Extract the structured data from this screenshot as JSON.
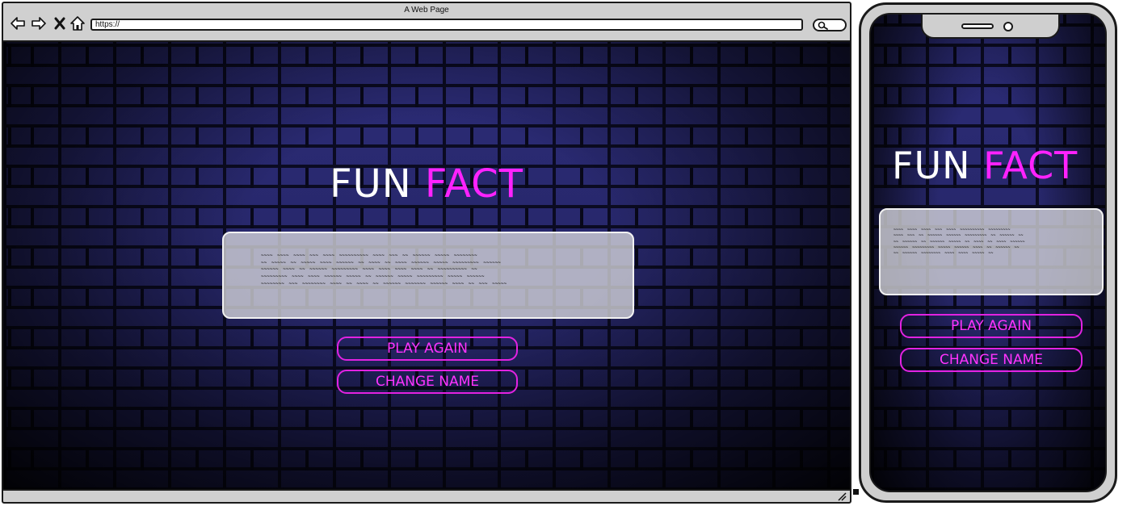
{
  "browser": {
    "window_title": "A Web Page",
    "url": "https://"
  },
  "page": {
    "title_word_1": "FUN",
    "title_word_2": "FACT",
    "fact_lines": [
      "~~~~ ~~~~ ~~~~ ~~~ ~~~~ ~~~~~~~~~~ ~~~~ ~~~ ~~ ~~~~~~ ~~~~~ ~~~~~~~~",
      "~~ ~~~~~ ~~ ~~~~~ ~~~~ ~~~~~~ ~~ ~~~~ ~~ ~~~~ ~~~~~~ ~~~~~ ~~~~~~~~~ ~~~~~~",
      "~~~~~~ ~~~~ ~~ ~~~~~~ ~~~~~~~~~ ~~~~ ~~~~ ~~~~ ~~~~ ~~ ~~~~~~~~~~ ~~",
      "~~~~~~~~~ ~~~~ ~~~~ ~~~~~~ ~~~~~ ~~ ~~~~~~ ~~~~~ ~~~~~~~~~ ~~~~~ ~~~~~~",
      "~~~~~~~~ ~~~ ~~~~~~~~ ~~~~ ~~ ~~~~ ~~ ~~~~~~ ~~~~~~~ ~~~~~~ ~~~~ ~~ ~~~ ~~~~~"
    ],
    "play_again_label": "PLAY AGAIN",
    "change_name_label": "CHANGE NAME"
  },
  "mobile": {
    "title_word_1": "FUN",
    "title_word_2": "FACT",
    "fact_lines": [
      "~~~~ ~~~~ ~~~~ ~~~ ~~~~ ~~~~~~~~~~ ~~~~~~~~~",
      "~~~~ ~~~ ~~ ~~~~~~ ~~~~~~ ~~~~~~~~~ ~~ ~~~~~~ ~~",
      "~~ ~~~~~~ ~~ ~~~~~~ ~~~~~ ~~ ~~~~ ~~ ~~~~ ~~~~~~",
      "~~~~~~ ~~~~~~~~~ ~~~~~ ~~~~~~ ~~~~ ~~ ~~~~~~ ~~",
      "~~ ~~~~~~ ~~~~~~~~ ~~~~ ~~~~ ~~~~~ ~~"
    ],
    "play_again_label": "PLAY AGAIN",
    "change_name_label": "CHANGE NAME"
  },
  "icons": {
    "back": "back-arrow-icon",
    "forward": "forward-arrow-icon",
    "close": "close-icon",
    "home": "home-icon",
    "search": "search-icon",
    "resize": "resize-grip-icon"
  },
  "colors": {
    "accent_magenta": "#ff22ff",
    "title_white": "#ffffff",
    "wall_brick": "#2a2a6e",
    "chrome_gray": "#d0d0d0"
  }
}
